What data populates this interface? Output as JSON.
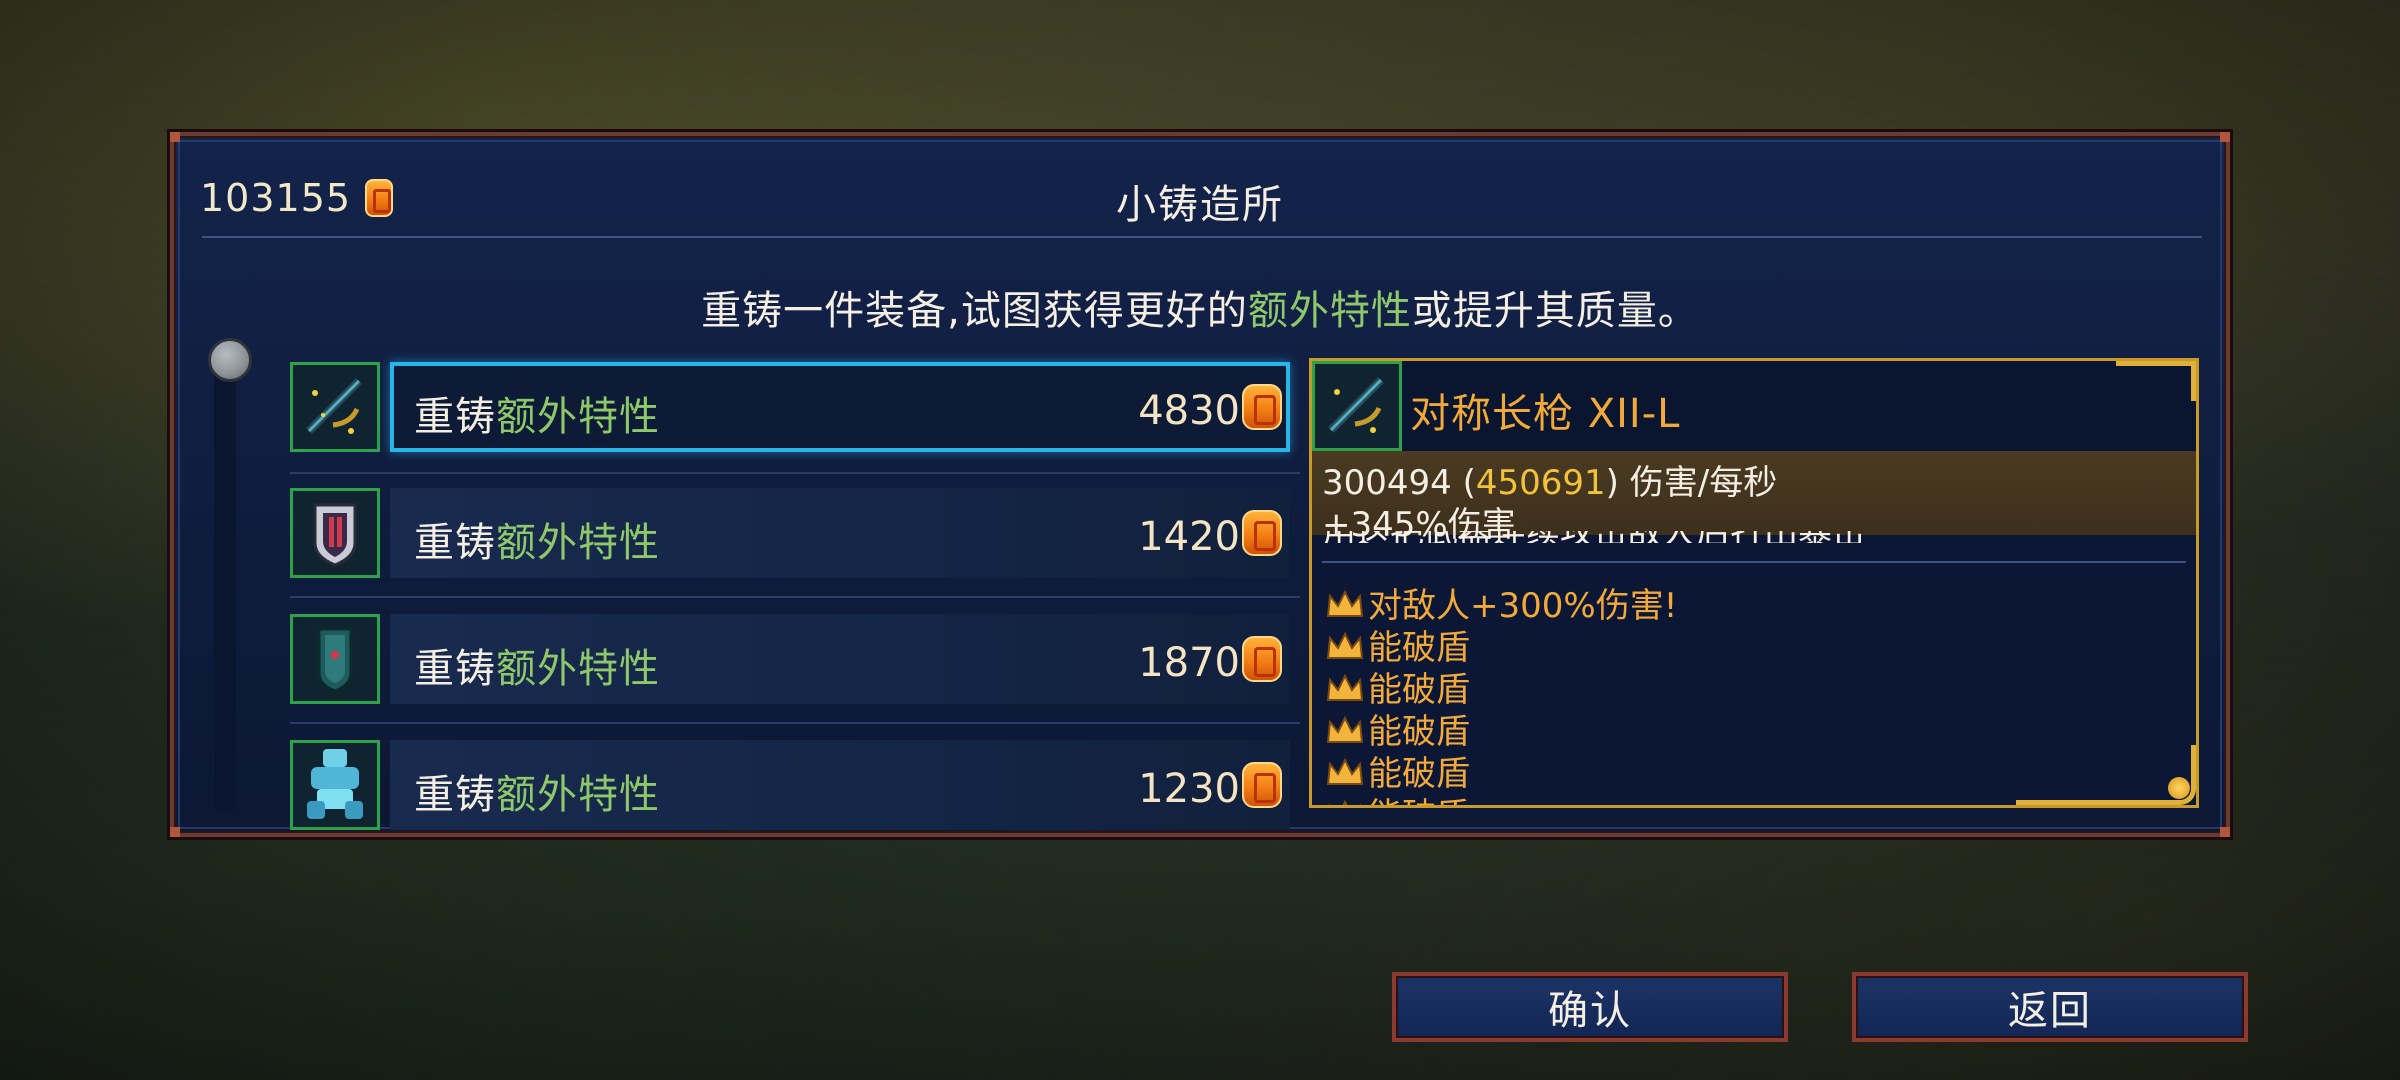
{
  "header": {
    "currency_amount": "103155",
    "title": "小铸造所",
    "subtitle_prefix": "重铸一件装备,试图获得更好的",
    "subtitle_highlight": "额外特性",
    "subtitle_suffix": "或提升其质量。"
  },
  "list": {
    "items": [
      {
        "label_prefix": "重铸",
        "label_highlight": "额外特性",
        "cost": "4830",
        "icon": "spear-icon",
        "selected": true
      },
      {
        "label_prefix": "重铸",
        "label_highlight": "额外特性",
        "cost": "1420",
        "icon": "shield-icon",
        "selected": false
      },
      {
        "label_prefix": "重铸",
        "label_highlight": "额外特性",
        "cost": "1870",
        "icon": "tower-shield-icon",
        "selected": false
      },
      {
        "label_prefix": "重铸",
        "label_highlight": "额外特性",
        "cost": "1230",
        "icon": "ice-armor-icon",
        "selected": false
      }
    ]
  },
  "detail": {
    "name": "对称长枪 XII-L",
    "dps_value": "300494",
    "dps_paren_open": " (",
    "dps_max": "450691",
    "dps_paren_close": ")",
    "dps_unit": " 伤害/每秒",
    "bonus": "+345%伤害",
    "hidden_line": "用这把武器连续攻击敌人后打出暴击",
    "traits": [
      "对敌人+300%伤害!",
      "能破盾",
      "能破盾",
      "能破盾",
      "能破盾",
      "能破盾"
    ]
  },
  "buttons": {
    "confirm": "确认",
    "back": "返回"
  },
  "colors": {
    "accent_green": "#8fc86b",
    "selection_blue": "#27b6e8",
    "trait_gold": "#f2a93a",
    "frame_red": "#8a3a30"
  }
}
